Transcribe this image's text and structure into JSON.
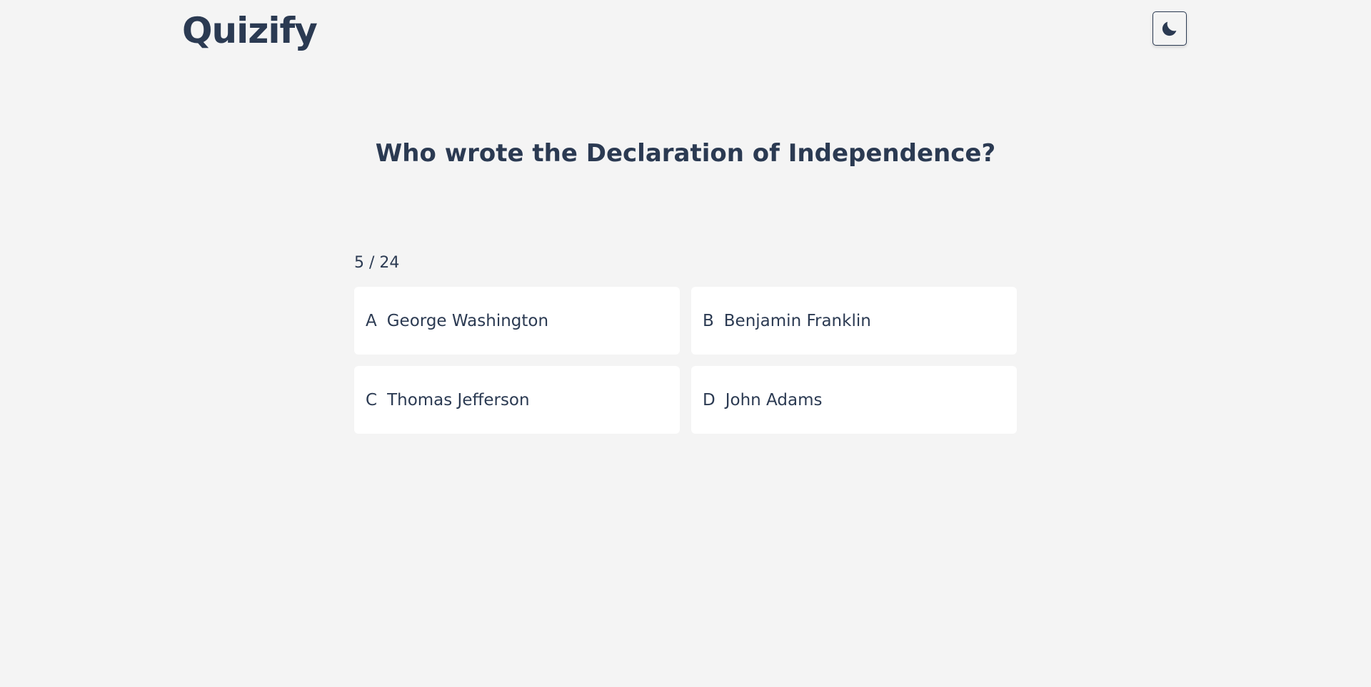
{
  "header": {
    "logo": "Quizify",
    "theme_toggle_icon": "moon-icon"
  },
  "quiz": {
    "question": "Who wrote the Declaration of Independence?",
    "progress": "5 / 24",
    "answers": [
      {
        "letter": "A",
        "text": "George Washington"
      },
      {
        "letter": "B",
        "text": "Benjamin Franklin"
      },
      {
        "letter": "C",
        "text": "Thomas Jefferson"
      },
      {
        "letter": "D",
        "text": "John Adams"
      }
    ]
  },
  "colors": {
    "background": "#f4f4f4",
    "text": "#2b3a52",
    "card": "#ffffff"
  }
}
